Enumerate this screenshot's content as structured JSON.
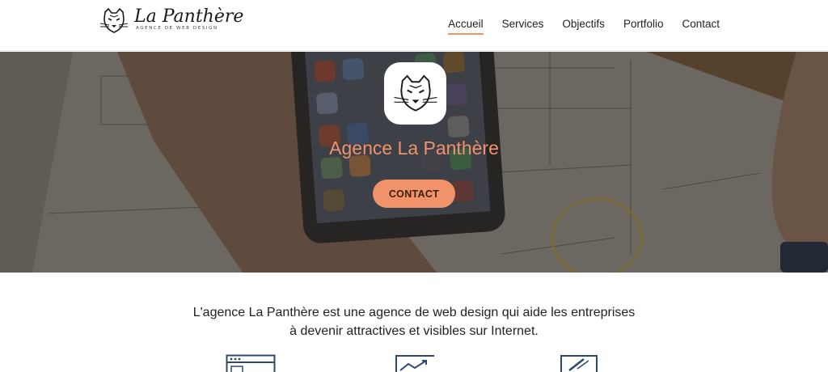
{
  "brand": {
    "name": "La Panthère",
    "tagline": "AGENCE DE WEB DESIGN"
  },
  "nav": {
    "items": [
      {
        "label": "Accueil",
        "active": true
      },
      {
        "label": "Services",
        "active": false
      },
      {
        "label": "Objectifs",
        "active": false
      },
      {
        "label": "Portfolio",
        "active": false
      },
      {
        "label": "Contact",
        "active": false
      }
    ]
  },
  "hero": {
    "title": "Agence La Panthère",
    "button_label": "CONTACT",
    "logo_icon": "panther-logo-icon"
  },
  "intro": {
    "line1": "L'agence La Panthère est une agence de web design qui aide les entreprises",
    "line2": "à devenir attractives et visibles sur Internet."
  },
  "features": {
    "icons": [
      "browser-window-icon",
      "chart-growth-icon",
      "design-edit-icon"
    ]
  },
  "colors": {
    "accent": "#f0926a",
    "text": "#222222",
    "icon_blue": "#2d4a6e"
  }
}
